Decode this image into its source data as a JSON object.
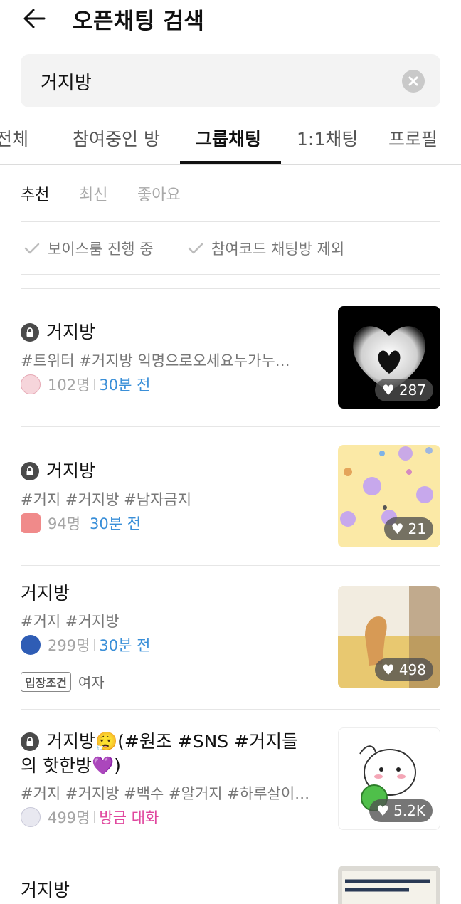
{
  "header": {
    "title": "오픈채팅 검색"
  },
  "search": {
    "value": "거지방"
  },
  "tabs": [
    {
      "label": "전체"
    },
    {
      "label": "참여중인 방"
    },
    {
      "label": "그룹채팅"
    },
    {
      "label": "1:1채팅"
    },
    {
      "label": "프로필"
    }
  ],
  "sort": [
    "추천",
    "최신",
    "좋아요"
  ],
  "filters": [
    "보이스룸 진행 중",
    "참여코드 채팅방 제외"
  ],
  "rooms": [
    {
      "locked": true,
      "title": "거지방",
      "tags": "#트위터 #거지방 익명으로오세요누가누…",
      "members": "102명",
      "time": "30분 전",
      "likes": "287"
    },
    {
      "locked": true,
      "title": "거지방",
      "tags": "#거지 #거지방 #남자금지",
      "members": "94명",
      "time": "30분 전",
      "likes": "21"
    },
    {
      "locked": false,
      "title": "거지방",
      "tags": "#거지 #거지방",
      "members": "299명",
      "time": "30분 전",
      "likes": "498",
      "condition_badge": "입장조건",
      "condition": "여자"
    },
    {
      "locked": true,
      "title_line1": "거지방😮‍💨(#원조 #SNS #거지들",
      "title_line2": "의 핫한방💜)",
      "tags": "#거지 #거지방 #백수 #알거지 #하루살이…",
      "members": "499명",
      "time": "방금 대화",
      "likes": "5.2K"
    },
    {
      "locked": false,
      "title": "거지방"
    }
  ],
  "colors": {
    "accent_blue": "#3a8fd8",
    "accent_pink": "#e0479e"
  }
}
